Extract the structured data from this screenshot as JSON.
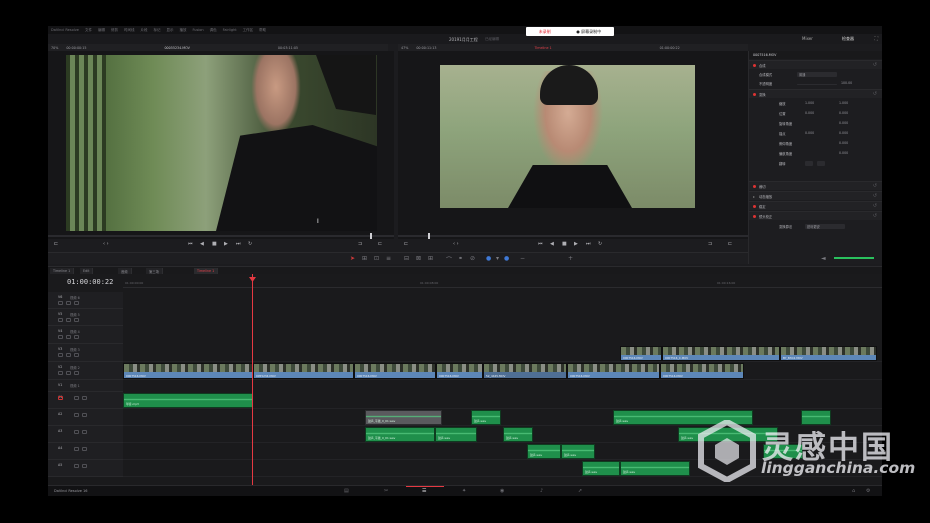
{
  "menubar": {
    "items": [
      "DaVinci Resolve",
      "文件",
      "编辑",
      "修剪",
      "时间线",
      "片段",
      "标记",
      "显示",
      "播放",
      "Fusion",
      "调色",
      "Fairlight",
      "工作区",
      "帮助"
    ]
  },
  "recording": {
    "pause": "未录制",
    "status": "● 屏幕录制中"
  },
  "titlebar": {
    "project": "20191月月工程",
    "edited": "已经编辑",
    "mixer": "Mixer",
    "inspector": "检查器"
  },
  "source_viewer": {
    "zoom": "70%",
    "timecode": "00:00:00:15",
    "clip": "00055234.MOV",
    "duration": "00:03:11:05"
  },
  "timeline_viewer": {
    "zoom": "47%",
    "timecode": "00:00:11:13",
    "timeline_name": "Timeline 1",
    "tc_right": "01:00:00:22"
  },
  "inspector": {
    "clip_name": "0007516.MOV",
    "rows": [
      {
        "label": "合成",
        "type": "section"
      },
      {
        "label": "合成模式",
        "value": "普通"
      },
      {
        "label": "不透明度",
        "value": "100.00"
      },
      {
        "label": "变换",
        "type": "section"
      },
      {
        "label": "缩放",
        "value": "1.000",
        "value2": "1.000"
      },
      {
        "label": "位置",
        "value": "0.000",
        "value2": "0.000"
      },
      {
        "label": "旋转角度",
        "value": "0.000"
      },
      {
        "label": "锚点",
        "value": "0.000",
        "value2": "0.000"
      },
      {
        "label": "俯仰角度",
        "value": "0.000"
      },
      {
        "label": "偏航角度",
        "value": "0.000"
      },
      {
        "label": "翻转",
        "value": ""
      },
      {
        "label": "裁切",
        "type": "section"
      },
      {
        "label": "动态缩放",
        "type": "collapsed"
      },
      {
        "label": "稳定",
        "type": "section"
      },
      {
        "label": "镜头校正",
        "type": "section"
      },
      {
        "label": "变换算法",
        "value": "锐利更锐"
      }
    ]
  },
  "tabs": [
    "Timeline 1",
    "Edit",
    "音频",
    "第三场",
    "Timeline 1"
  ],
  "timeline": {
    "timecode": "01:00:00:22",
    "ruler": [
      "01:00:00:00",
      "01:00:08:00",
      "01:00:16:00"
    ],
    "video_tracks": [
      {
        "id": "V6",
        "name": "视频 6"
      },
      {
        "id": "V5",
        "name": "视频 5"
      },
      {
        "id": "V4",
        "name": "视频 4"
      },
      {
        "id": "V3",
        "name": "视频 3"
      },
      {
        "id": "V2",
        "name": "视频 2"
      },
      {
        "id": "V1",
        "name": "视频 1"
      }
    ],
    "audio_tracks": [
      {
        "id": "A1",
        "name": ""
      },
      {
        "id": "A2",
        "name": ""
      },
      {
        "id": "A3",
        "name": ""
      },
      {
        "id": "A4",
        "name": ""
      },
      {
        "id": "A5",
        "name": ""
      }
    ],
    "v3_clips": [
      "0007516.MOV",
      "0007516_C.MOV",
      "BY_B3C2.MOV"
    ],
    "v2_clips": [
      "0007516.MOV",
      "0055234.MOV",
      "0007516.MOV",
      "0007516.MOV",
      "52_4445.MOV",
      "0007516.MOV",
      "0007516.MOV"
    ],
    "audio_clips": [
      "琴音.mp3",
      "鼓声_平庸_0_01.wav",
      "鼓声.wav",
      "鼓声_平庸_0_01.wav",
      "鼓声.wav",
      "鼓声.wav",
      "鼓声.wav",
      "鼓声.wav",
      "鼓声.wav",
      "鼓声.wav"
    ]
  },
  "pages": {
    "brand": "DaVinci Resolve 16"
  },
  "watermark": {
    "cn": "灵感中国",
    "en": "lingganchina.com"
  }
}
